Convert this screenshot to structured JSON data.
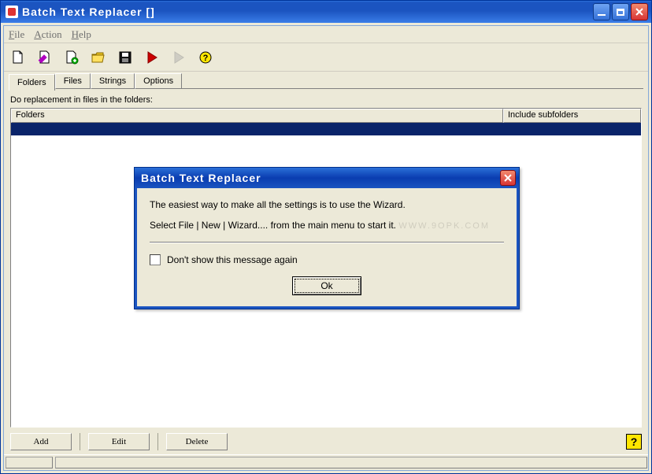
{
  "window": {
    "title": "Batch Text Replacer []"
  },
  "menu": {
    "file": "File",
    "action": "Action",
    "help": "Help"
  },
  "toolbar": {
    "icons": {
      "new": "new-file-icon",
      "edit": "edit-file-icon",
      "newfolder": "new-folder-icon",
      "open": "open-folder-icon",
      "save": "save-icon",
      "run": "run-icon",
      "runstep": "run-step-icon",
      "help": "help-icon"
    }
  },
  "tabs": {
    "t0": "Folders",
    "t1": "Files",
    "t2": "Strings",
    "t3": "Options",
    "active": 0
  },
  "folders_page": {
    "instruction": "Do replacement in files in the folders:",
    "col_folders": "Folders",
    "col_include": "Include subfolders",
    "btn_add": "Add",
    "btn_edit": "Edit",
    "btn_delete": "Delete"
  },
  "dialog": {
    "title": "Batch Text Replacer",
    "line1": "The easiest way to make all the settings is to use the Wizard.",
    "line2": "Select File | New | Wizard.... from the main menu to start it.",
    "checkbox_label": "Don't show this message again",
    "ok": "Ok"
  }
}
